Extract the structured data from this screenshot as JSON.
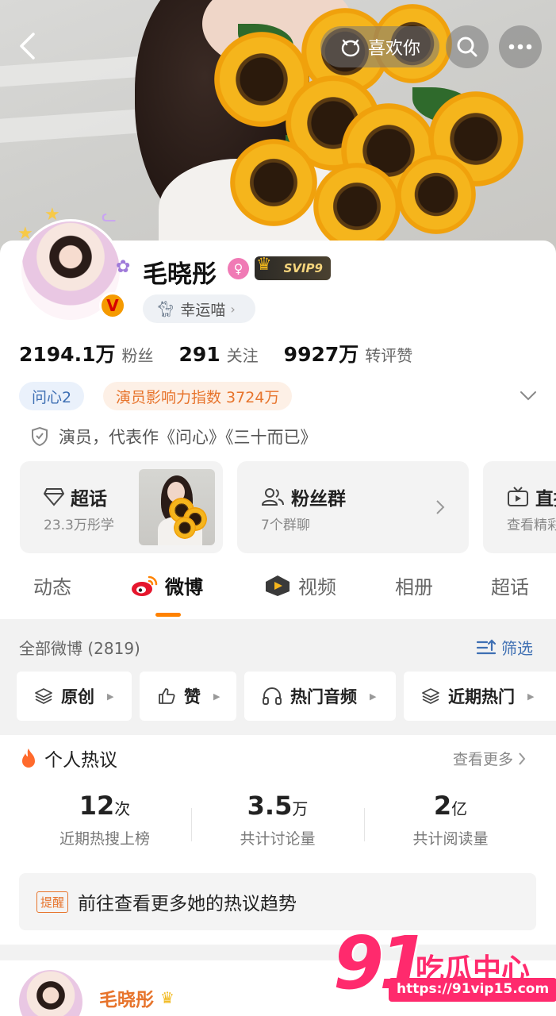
{
  "header": {
    "like_label": "喜欢你"
  },
  "profile": {
    "name": "毛晓彤",
    "svip": "SVIP9",
    "lucky_label": "幸运喵",
    "stats": [
      {
        "value": "2194.1万",
        "label": "粉丝"
      },
      {
        "value": "291",
        "label": "关注"
      },
      {
        "value": "9927万",
        "label": "转评赞"
      }
    ],
    "tags": [
      "问心2",
      "演员影响力指数 3724万"
    ],
    "role": "演员，代表作《问心》《三十而已》"
  },
  "feature_boxes": [
    {
      "title": "超话",
      "sub": "23.3万彤学"
    },
    {
      "title": "粉丝群",
      "sub": "7个群聊"
    },
    {
      "title": "直播",
      "sub": "查看精彩"
    }
  ],
  "tabs": [
    "动态",
    "微博",
    "视频",
    "相册",
    "超话"
  ],
  "active_tab": "微博",
  "filter": {
    "all_label": "全部微博 (2819)",
    "filter_label": "筛选",
    "chips": [
      "原创",
      "赞",
      "热门音频",
      "近期热门"
    ]
  },
  "hot": {
    "title": "个人热议",
    "more": "查看更多",
    "metrics": [
      {
        "value": "12",
        "unit": "次",
        "label": "近期热搜上榜"
      },
      {
        "value": "3.5",
        "unit": "万",
        "label": "共计讨论量"
      },
      {
        "value": "2",
        "unit": "亿",
        "label": "共计阅读量"
      }
    ],
    "remind_badge": "提醒",
    "remind_text": "前往查看更多她的热议趋势"
  },
  "post": {
    "author": "毛晓彤"
  },
  "watermark": {
    "number": "91",
    "text": "吃瓜中心",
    "url": "https://91vip15.com"
  },
  "colors": {
    "accent": "#ff8200",
    "link": "#3e6fb3",
    "orange_tag": "#e7742c"
  }
}
